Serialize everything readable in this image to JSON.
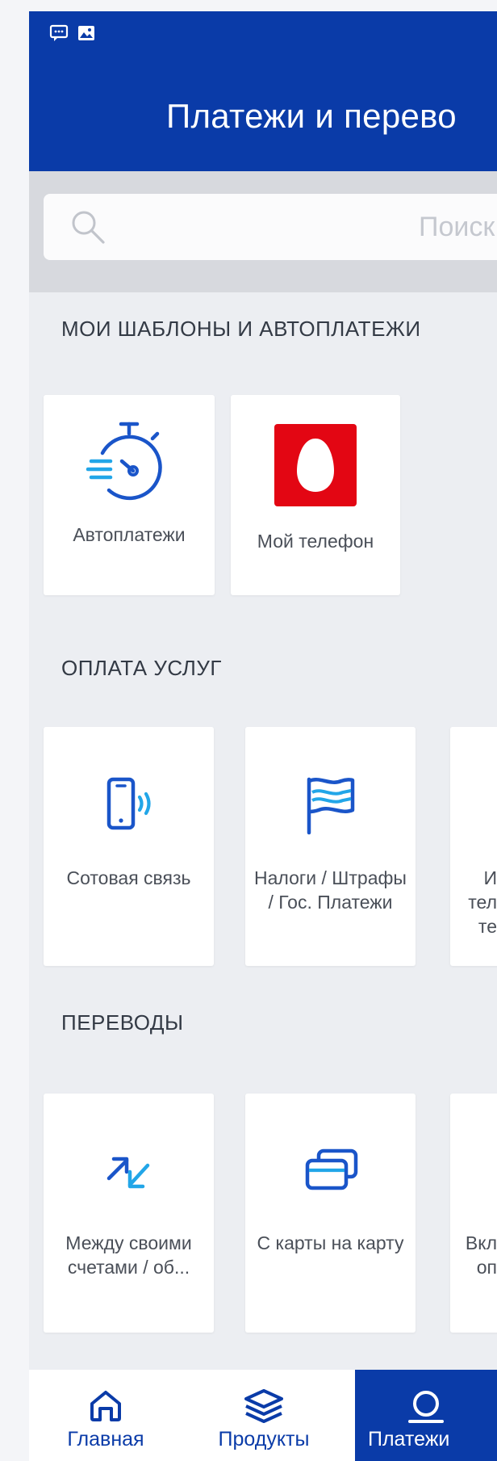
{
  "header": {
    "title": "Платежи и перево",
    "status_icons": [
      "message-icon",
      "image-icon"
    ]
  },
  "search": {
    "placeholder": "Поиск"
  },
  "sections": {
    "templates": {
      "title": "МОИ ШАБЛОНЫ И АВТОПЛАТЕЖИ",
      "items": [
        {
          "label": "Автоплатежи",
          "icon": "stopwatch-icon"
        },
        {
          "label": "Мой телефон",
          "icon": "mts-egg-logo"
        }
      ]
    },
    "services": {
      "title": "ОПЛАТА УСЛУГ",
      "items": [
        {
          "label": "Сотовая связь",
          "icon": "phone-signal-icon"
        },
        {
          "label": "Налоги / Штрафы / Гос. Платежи",
          "icon": "flag-icon"
        },
        {
          "label": "И тел те",
          "icon": "tv-icon"
        }
      ]
    },
    "transfers": {
      "title": "ПЕРЕВОДЫ",
      "items": [
        {
          "label": "Между своими счетами / об...",
          "icon": "arrows-icon"
        },
        {
          "label": "С карты на карту",
          "icon": "cards-icon"
        },
        {
          "label": "Вкл оп",
          "icon": "deposit-icon"
        }
      ]
    }
  },
  "bottom_nav": [
    {
      "label": "Главная",
      "icon": "home-icon"
    },
    {
      "label": "Продукты",
      "icon": "layers-icon"
    },
    {
      "label": "Платежи",
      "icon": "payments-icon"
    }
  ],
  "colors": {
    "brand": "#0a3ba8",
    "icon_blue": "#1a55c9",
    "icon_cyan": "#22a6e8",
    "mts_red": "#e30613"
  }
}
